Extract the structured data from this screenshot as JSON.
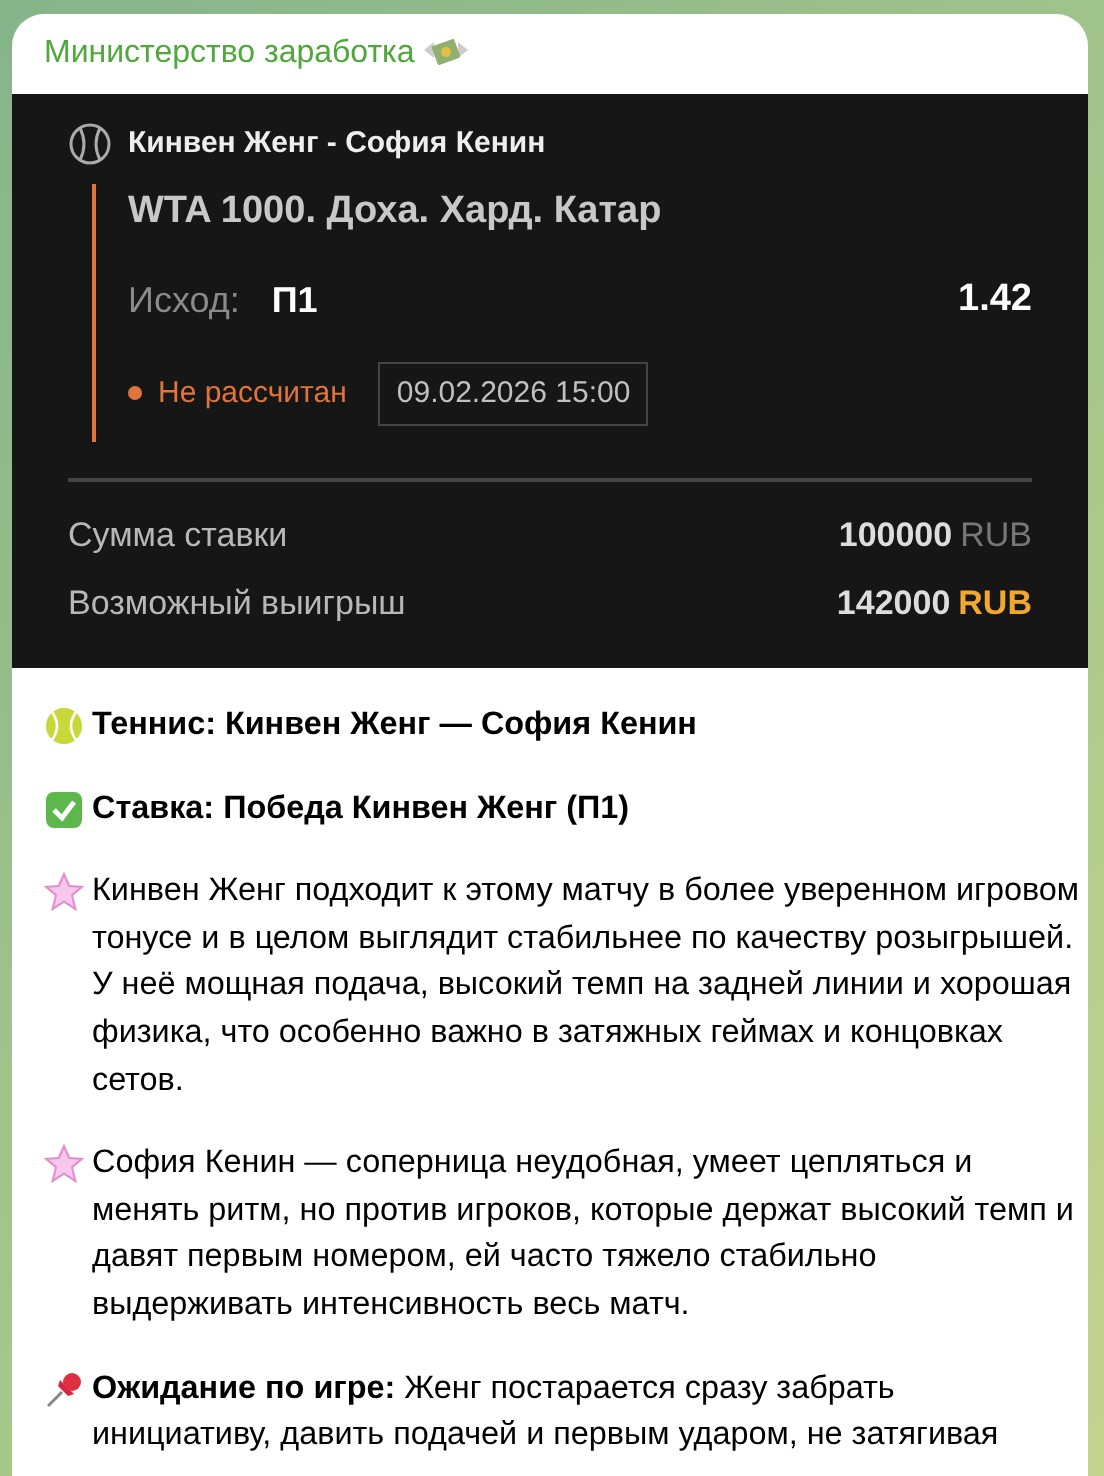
{
  "message": {
    "sender": "Министерство заработка",
    "bet_card": {
      "match": "Кинвен Женг - София Кенин",
      "tournament": "WTA 1000. Доха. Хард. Катар",
      "outcome_label": "Исход:",
      "outcome_value": "П1",
      "odds": "1.42",
      "status": "Не рассчитан",
      "datetime": "09.02.2026 15:00",
      "totals": [
        {
          "label": "Сумма ставки",
          "amount": "100000",
          "currency": "RUB",
          "highlight": false
        },
        {
          "label": "Возможный выигрыш",
          "amount": "142000",
          "currency": "RUB",
          "highlight": true
        }
      ]
    },
    "paragraphs": [
      {
        "kind": "tennis",
        "bold": true,
        "text": "Теннис: Кинвен Женг — София Кенин"
      },
      {
        "kind": "check",
        "bold": true,
        "text": "Ставка: Победа Кинвен Женг (П1)"
      },
      {
        "kind": "star",
        "bold": false,
        "text": "Кинвен Женг подходит к этому матчу в более уверенном игровом тонусе и в целом выглядит стабильнее по качеству розыгрышей. У неё мощная подача, высокий темп на задней линии и хорошая физика, что особенно важно в затяжных геймах и концовках сетов."
      },
      {
        "kind": "star",
        "bold": false,
        "text": "София Кенин — соперница неудобная, умеет цепляться и менять ритм, но против игроков, которые держат высокий темп и давят первым номером, ей часто тяжело стабильно выдерживать интенсивность весь матч."
      },
      {
        "kind": "pin",
        "bold": false,
        "text": "**Ожидание по игре:** Женг постарается сразу забрать инициативу, давить подачей и первым ударом, не затягивая"
      }
    ]
  }
}
